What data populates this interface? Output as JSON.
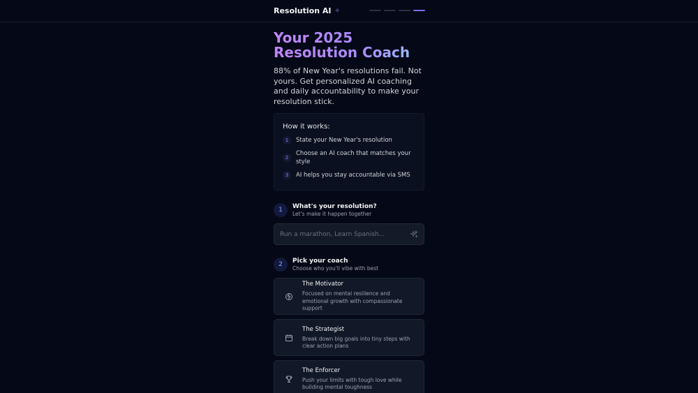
{
  "header": {
    "brand": "Resolution AI",
    "brand_icon": "sparkle-icon",
    "progress": {
      "total": 4,
      "current": 4
    }
  },
  "hero": {
    "title_line1": "Your 2025",
    "title_line2": "Resolution Coach",
    "subtitle": "88% of New Year's resolutions fail. Not yours. Get personalized AI coaching and daily accountability to make your resolution stick."
  },
  "how_it_works": {
    "title": "How it works:",
    "steps": [
      {
        "num": "1",
        "text": "State your New Year's resolution"
      },
      {
        "num": "2",
        "text": "Choose an AI coach that matches your style"
      },
      {
        "num": "3",
        "text": "AI helps you stay accountable via SMS"
      }
    ]
  },
  "section1": {
    "num": "1",
    "title": "What's your resolution?",
    "subtitle": "Let's make it happen together",
    "input": {
      "placeholder": "Run a marathon, Learn Spanish...",
      "value": ""
    }
  },
  "section2": {
    "num": "2",
    "title": "Pick your coach",
    "subtitle": "Choose who you'll vibe with best",
    "coaches": [
      {
        "name": "The Motivator",
        "desc": "Focused on mental resilience and emotional growth with compassionate support",
        "icon": "brain-icon"
      },
      {
        "name": "The Strategist",
        "desc": "Break down big goals into tiny steps with clear action plans",
        "icon": "calendar-icon"
      },
      {
        "name": "The Enforcer",
        "desc": "Push your limits with tough love while building mental toughness",
        "icon": "trophy-icon"
      }
    ]
  },
  "colors": {
    "background": "#050816",
    "accent": "#7c6cf0",
    "title_gradient_start": "#c084fc",
    "title_gradient_end": "#93c5fd"
  }
}
